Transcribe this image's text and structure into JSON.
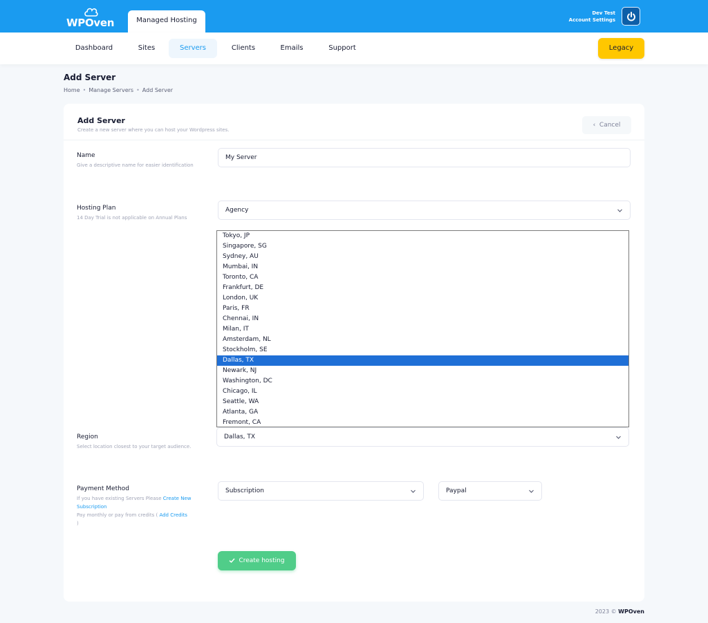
{
  "brand": {
    "logo_text": "WPOven",
    "top_tab": "Managed Hosting"
  },
  "account": {
    "user": "Dev Test",
    "settings": "Account Settings",
    "icon": "power-icon"
  },
  "nav": {
    "items": [
      "Dashboard",
      "Sites",
      "Servers",
      "Clients",
      "Emails",
      "Support"
    ],
    "active": "Servers",
    "legacy": "Legacy"
  },
  "page": {
    "title": "Add Server",
    "breadcrumb": [
      "Home",
      "Manage Servers",
      "Add Server"
    ]
  },
  "card": {
    "title": "Add Server",
    "subtitle": "Create a new server where you can host your Wordpress sites.",
    "cancel": "Cancel"
  },
  "form": {
    "name": {
      "label": "Name",
      "help": "Give a descriptive name for easier identification",
      "value": "My Server"
    },
    "plan": {
      "label": "Hosting Plan",
      "help": "14 Day Trial is not applicable on Annual Plans",
      "value": "Agency"
    },
    "region": {
      "label": "Region",
      "help": "Select location closest to your target audience.",
      "value": "Dallas, TX",
      "options": [
        "Tokyo, JP",
        "Singapore, SG",
        "Sydney, AU",
        "Mumbai, IN",
        "Toronto, CA",
        "Frankfurt, DE",
        "London, UK",
        "Paris, FR",
        "Chennai, IN",
        "Milan, IT",
        "Amsterdam, NL",
        "Stockholm, SE",
        "Dallas, TX",
        "Newark, NJ",
        "Washington, DC",
        "Chicago, IL",
        "Seattle, WA",
        "Atlanta, GA",
        "Fremont, CA"
      ],
      "highlighted_index": 12
    },
    "payment": {
      "label": "Payment Method",
      "help_prefix": "If you have existing Servers Please ",
      "help_link": "Create New Subscription",
      "help_credits_prefix": "Pay monthly or pay from credits ( ",
      "help_credits_link": "Add Credits",
      "help_credits_suffix": " )",
      "method": "Subscription",
      "gateway": "Paypal"
    },
    "submit": "Create hosting"
  },
  "footer": {
    "year": "2023 ©",
    "brand": "WPOven"
  },
  "colors": {
    "primary": "#1a9bf0",
    "legacy": "#ffc700",
    "success": "#50cd89",
    "selected": "#1f6fd6"
  }
}
